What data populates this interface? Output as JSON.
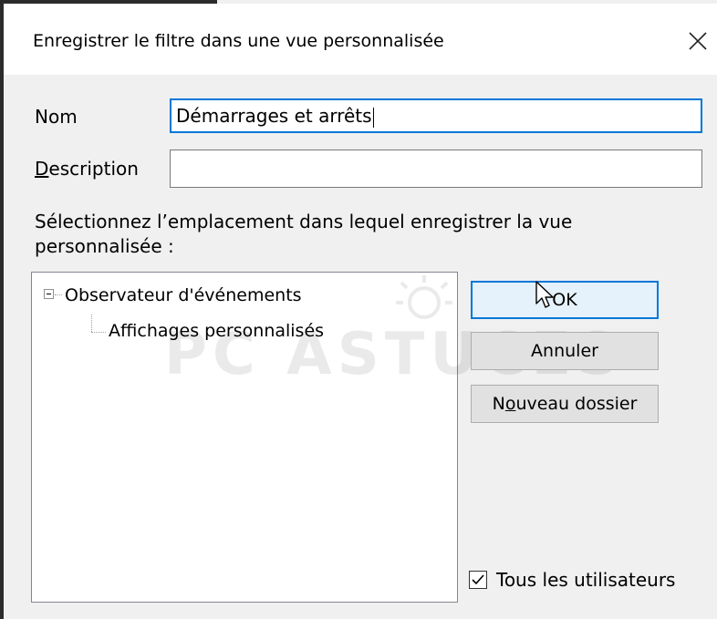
{
  "dialog": {
    "title": "Enregistrer le filtre dans une vue personnalisée"
  },
  "form": {
    "name_label": "Nom",
    "name_value": "Démarrages et arrêts",
    "description_label_mnemonic": "D",
    "description_label_rest": "escription",
    "description_value": "",
    "location_prompt_line1": "Sélectionnez l’emplacement dans lequel enregistrer la vue",
    "location_prompt_line2": "personnalisée :"
  },
  "tree": {
    "root_label": "Observateur d'événements",
    "child_label": "Affichages personnalisés"
  },
  "buttons": {
    "ok_label": "OK",
    "cancel_label": "Annuler",
    "new_folder_prefix": "N",
    "new_folder_mnemonic": "o",
    "new_folder_rest": "uveau dossier"
  },
  "options": {
    "all_users_label": "Tous les utilisateurs",
    "all_users_checked": true
  },
  "watermark": {
    "text": "PC ASTUCES"
  },
  "colors": {
    "focus_blue": "#0078d7",
    "default_button_fill": "#e5f1fb"
  }
}
